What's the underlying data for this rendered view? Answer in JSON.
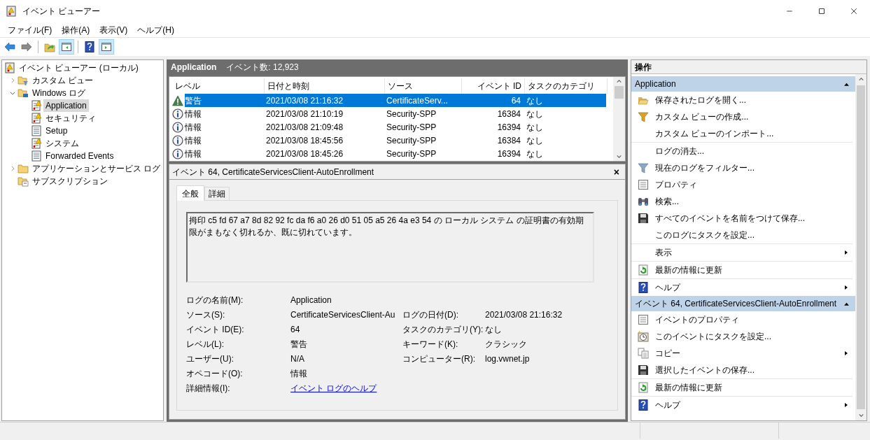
{
  "window": {
    "title": "イベント ビューアー"
  },
  "menu": [
    "ファイル(F)",
    "操作(A)",
    "表示(V)",
    "ヘルプ(H)"
  ],
  "toolbar": [
    {
      "kind": "back",
      "on": false
    },
    {
      "kind": "forward",
      "on": false
    },
    {
      "kind": "up",
      "on": false
    },
    {
      "kind": "tree",
      "on": true
    },
    {
      "kind": "help",
      "on": false
    },
    {
      "kind": "actions",
      "on": true
    }
  ],
  "tree": [
    {
      "label": "イベント ビューアー (ローカル)",
      "kind": "viewer",
      "selected": false,
      "children": [
        {
          "label": "カスタム ビュー",
          "kind": "folder-filter",
          "expanded": false,
          "selected": false
        },
        {
          "label": "Windows ログ",
          "kind": "folder-windows",
          "expanded": true,
          "selected": false,
          "children": [
            {
              "label": "Application",
              "kind": "log-warning",
              "selected": true
            },
            {
              "label": "セキュリティ",
              "kind": "log-warning",
              "selected": false
            },
            {
              "label": "Setup",
              "kind": "log",
              "selected": false
            },
            {
              "label": "システム",
              "kind": "log-warning",
              "selected": false
            },
            {
              "label": "Forwarded Events",
              "kind": "log",
              "selected": false
            }
          ]
        },
        {
          "label": "アプリケーションとサービス ログ",
          "kind": "folder",
          "expanded": false,
          "selected": false
        },
        {
          "label": "サブスクリプション",
          "kind": "subscription",
          "selected": false
        }
      ]
    }
  ],
  "log_header": {
    "title": "Application",
    "count": "イベント数: 12,923"
  },
  "table": {
    "columns": [
      "レベル",
      "日付と時刻",
      "ソース",
      "イベント ID",
      "タスクのカテゴリ"
    ],
    "rows": [
      {
        "kind": "warning",
        "level": "警告",
        "date": "2021/03/08 21:16:32",
        "source": "CertificateServ...",
        "event_id": "64",
        "category": "なし",
        "selected": true
      },
      {
        "kind": "info",
        "level": "情報",
        "date": "2021/03/08 21:10:19",
        "source": "Security-SPP",
        "event_id": "16384",
        "category": "なし",
        "selected": false
      },
      {
        "kind": "info",
        "level": "情報",
        "date": "2021/03/08 21:09:48",
        "source": "Security-SPP",
        "event_id": "16394",
        "category": "なし",
        "selected": false
      },
      {
        "kind": "info",
        "level": "情報",
        "date": "2021/03/08 18:45:56",
        "source": "Security-SPP",
        "event_id": "16384",
        "category": "なし",
        "selected": false
      },
      {
        "kind": "info",
        "level": "情報",
        "date": "2021/03/08 18:45:26",
        "source": "Security-SPP",
        "event_id": "16394",
        "category": "なし",
        "selected": false
      }
    ]
  },
  "detail": {
    "title": "イベント 64, CertificateServicesClient-AutoEnrollment",
    "close": "×",
    "tabs": [
      {
        "label": "全般",
        "selected": true
      },
      {
        "label": "詳細",
        "selected": false
      }
    ],
    "message": "拇印 c5 fd 67 a7 8d 82 92 fc da f6 a0 26 d0 51 05 a5 26 4a e3 54 の ローカル システム の証明書の有効期限がまもなく切れるか、既に切れています。",
    "rows": [
      {
        "left": {
          "label": "ログの名前(M):",
          "value": "Application",
          "kind": "text"
        }
      },
      {
        "left": {
          "label": "ソース(S):",
          "value": "CertificateServicesClient-Au",
          "kind": "text"
        },
        "right": {
          "label": "ログの日付(D):",
          "value": "2021/03/08 21:16:32",
          "kind": "text"
        }
      },
      {
        "left": {
          "label": "イベント ID(E):",
          "value": "64",
          "kind": "text"
        },
        "right": {
          "label": "タスクのカテゴリ(Y):",
          "value": "なし",
          "kind": "text"
        }
      },
      {
        "left": {
          "label": "レベル(L):",
          "value": "警告",
          "kind": "text"
        },
        "right": {
          "label": "キーワード(K):",
          "value": "クラシック",
          "kind": "text"
        }
      },
      {
        "left": {
          "label": "ユーザー(U):",
          "value": "N/A",
          "kind": "text"
        },
        "right": {
          "label": "コンピューター(R):",
          "value": "log.vwnet.jp",
          "kind": "text"
        }
      },
      {
        "left": {
          "label": "オペコード(O):",
          "value": "情報",
          "kind": "text"
        }
      },
      {
        "left": {
          "label": "詳細情報(I):",
          "value": "イベント ログのヘルプ",
          "kind": "link"
        }
      }
    ]
  },
  "actions": {
    "title": "操作",
    "sections": [
      {
        "title": "Application",
        "expanded": true,
        "groups": [
          [
            {
              "label": "保存されたログを開く...",
              "kind": "folder-open",
              "submenu": false
            },
            {
              "label": "カスタム ビューの作成...",
              "kind": "funnel-gold",
              "submenu": false
            },
            {
              "label": "カスタム ビューのインポート...",
              "kind": "plain",
              "submenu": false
            }
          ],
          [
            {
              "label": "ログの消去...",
              "kind": "plain",
              "submenu": false
            },
            {
              "label": "現在のログをフィルター...",
              "kind": "funnel",
              "submenu": false
            },
            {
              "label": "プロパティ",
              "kind": "properties",
              "submenu": false
            },
            {
              "label": "検索...",
              "kind": "binoculars",
              "submenu": false
            },
            {
              "label": "すべてのイベントを名前をつけて保存...",
              "kind": "floppy",
              "submenu": false
            },
            {
              "label": "このログにタスクを設定...",
              "kind": "plain",
              "submenu": false
            }
          ],
          [
            {
              "label": "表示",
              "kind": "plain",
              "submenu": true
            }
          ],
          [
            {
              "label": "最新の情報に更新",
              "kind": "refresh",
              "submenu": false
            }
          ],
          [
            {
              "label": "ヘルプ",
              "kind": "help",
              "submenu": true
            }
          ]
        ]
      },
      {
        "title": "イベント 64, CertificateServicesClient-AutoEnrollment",
        "expanded": true,
        "groups": [
          [
            {
              "label": "イベントのプロパティ",
              "kind": "properties",
              "submenu": false
            },
            {
              "label": "このイベントにタスクを設定...",
              "kind": "clock",
              "submenu": false
            },
            {
              "label": "コピー",
              "kind": "copy",
              "submenu": true
            },
            {
              "label": "選択したイベントの保存...",
              "kind": "floppy",
              "submenu": false
            }
          ],
          [
            {
              "label": "最新の情報に更新",
              "kind": "refresh",
              "submenu": false
            }
          ],
          [
            {
              "label": "ヘルプ",
              "kind": "help",
              "submenu": true
            }
          ]
        ]
      }
    ]
  }
}
